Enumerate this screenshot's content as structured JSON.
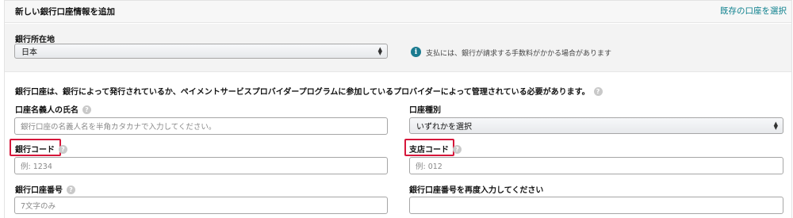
{
  "header": {
    "title": "新しい銀行口座情報を追加",
    "select_existing_link": "既存の口座を選択"
  },
  "country": {
    "label": "銀行所在地",
    "selected": "日本",
    "info_text": "支払には、銀行が請求する手数料がかかる場合があります"
  },
  "notice": "銀行口座は、銀行によって発行されているか、ペイメントサービスプロバイダープログラムに参加しているプロバイダーによって管理されている必要があります。",
  "fields": {
    "holder_name": {
      "label": "口座名義人の氏名",
      "placeholder": "銀行口座の名義人名を半角カタカナで入力してください。"
    },
    "account_type": {
      "label": "口座種別",
      "selected": "いずれかを選択"
    },
    "bank_code": {
      "label": "銀行コード",
      "placeholder": "例: 1234"
    },
    "branch_code": {
      "label": "支店コード",
      "placeholder": "例: 012"
    },
    "account_number": {
      "label": "銀行口座番号",
      "placeholder": "7文字のみ"
    },
    "account_number_confirm": {
      "label": "銀行口座番号を再度入力してください",
      "placeholder": ""
    }
  },
  "colors": {
    "link": "#0b7f8c",
    "info_icon": "#1b7b90",
    "highlight": "#d6163a"
  }
}
